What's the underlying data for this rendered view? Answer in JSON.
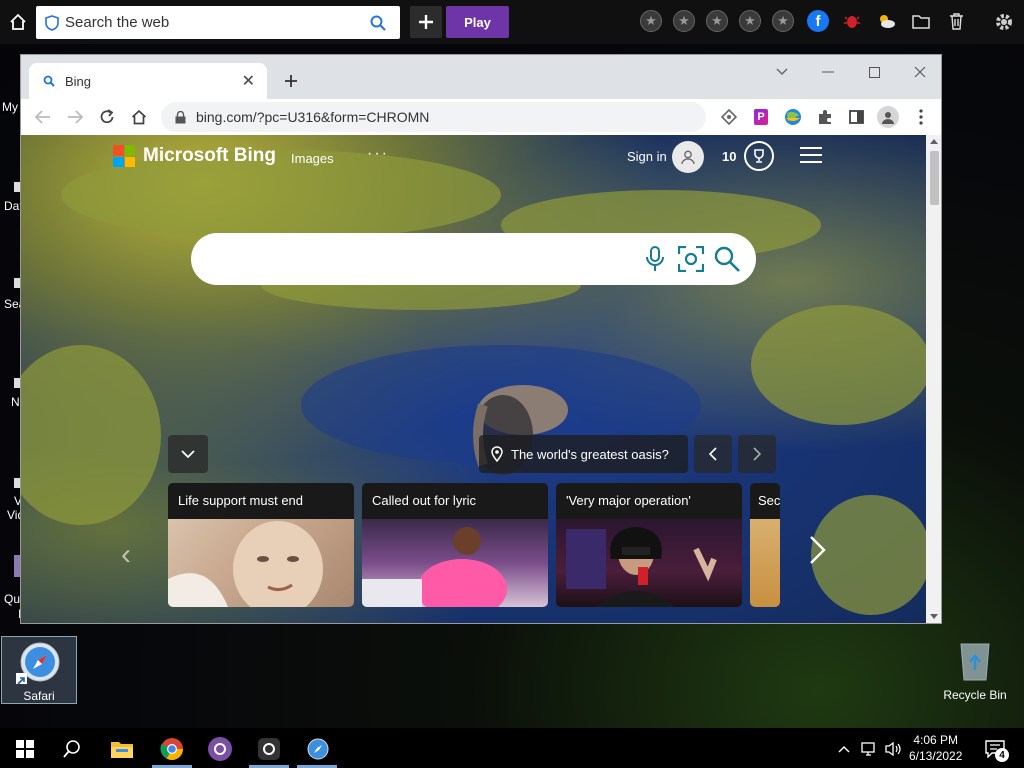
{
  "top_bar": {
    "search_placeholder": "Search the web",
    "play_label": "Play"
  },
  "desktop": {
    "left_fragments": [
      "My",
      "Dat",
      "Sea",
      "N",
      "V",
      "Vid",
      "Qu",
      "I"
    ],
    "safari_label": "Safari",
    "recycle_label": "Recycle Bin"
  },
  "browser": {
    "tab_title": "Bing",
    "url": "bing.com/?pc=U316&form=CHROMN",
    "colors": {
      "accent": "#dee1e6",
      "omnibox": "#f1f3f4"
    }
  },
  "bing": {
    "brand": "Microsoft Bing",
    "images_label": "Images",
    "more_label": "···",
    "sign_in": "Sign in",
    "points": "10",
    "image_info": "The world's greatest oasis?",
    "cards": [
      {
        "title": "Life support must end"
      },
      {
        "title": "Called out for lyric"
      },
      {
        "title": "'Very major operation'"
      },
      {
        "title": "Sec"
      }
    ]
  },
  "taskbar": {
    "time": "4:06 PM",
    "date": "6/13/2022",
    "notification_count": "4"
  }
}
